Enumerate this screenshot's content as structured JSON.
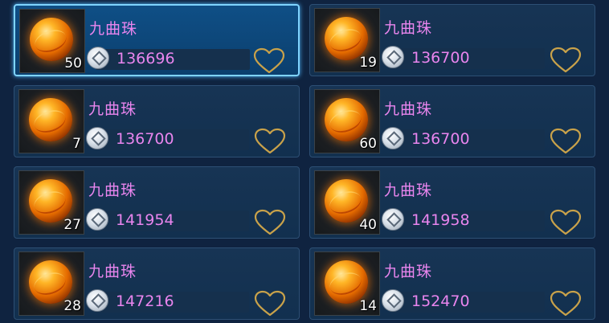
{
  "items": [
    {
      "name": "九曲珠",
      "count": "50",
      "price": "136696",
      "selected": true
    },
    {
      "name": "九曲珠",
      "count": "19",
      "price": "136700",
      "selected": false
    },
    {
      "name": "九曲珠",
      "count": "7",
      "price": "136700",
      "selected": false
    },
    {
      "name": "九曲珠",
      "count": "60",
      "price": "136700",
      "selected": false
    },
    {
      "name": "九曲珠",
      "count": "27",
      "price": "141954",
      "selected": false
    },
    {
      "name": "九曲珠",
      "count": "40",
      "price": "141958",
      "selected": false
    },
    {
      "name": "九曲珠",
      "count": "28",
      "price": "147216",
      "selected": false
    },
    {
      "name": "九曲珠",
      "count": "14",
      "price": "152470",
      "selected": false
    }
  ],
  "icons": {
    "item": "orange-orb-icon",
    "currency": "silver-coin-icon",
    "favorite": "heart-outline-icon"
  },
  "colors": {
    "text_accent": "#e985ee",
    "heart": "#c9a24a",
    "selected_border": "#7fd4ff"
  }
}
